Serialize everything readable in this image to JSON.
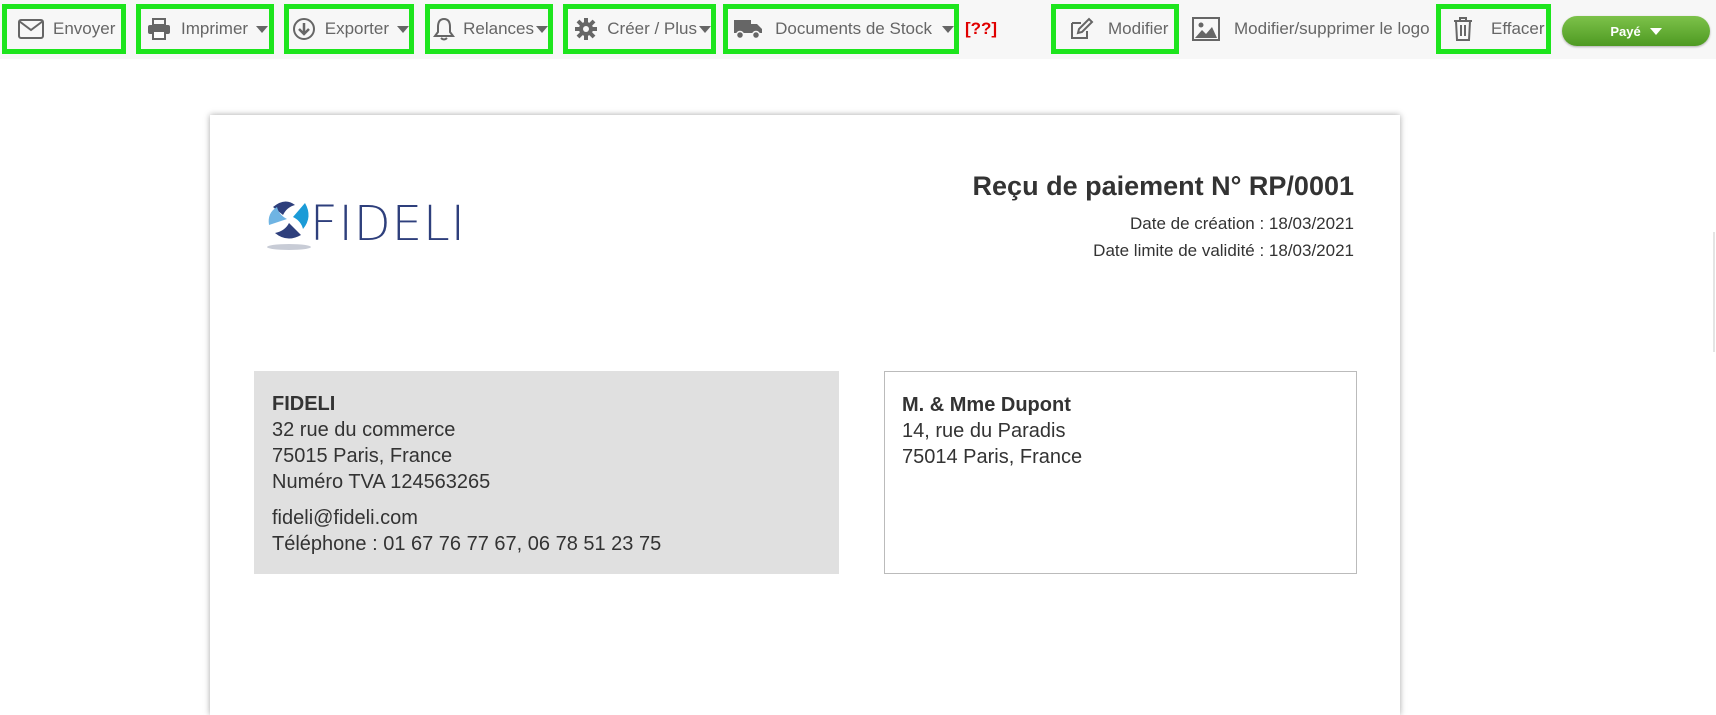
{
  "toolbar": {
    "send": "Envoyer",
    "print": "Imprimer",
    "export": "Exporter",
    "reminders": "Relances",
    "create": "Créer / Plus",
    "stock": "Documents de Stock",
    "warning": "[??]",
    "edit": "Modifier",
    "logo": "Modifier/supprimer le logo",
    "delete": "Effacer",
    "status": "Payé"
  },
  "document": {
    "logo_text": "FIDELI",
    "title": "Reçu de paiement N° RP/0001",
    "created": "Date de création : 18/03/2021",
    "valid": "Date limite de validité : 18/03/2021",
    "sender": {
      "name": "FIDELI",
      "street": "32 rue du commerce",
      "city": "75015 Paris, France",
      "vat": "Numéro TVA 124563265",
      "email": "fideli@fideli.com",
      "phone": "Téléphone : 01 67 76 77 67, 06 78 51 23 75"
    },
    "recipient": {
      "name": "M. & Mme Dupont",
      "street": "14, rue du Paradis",
      "city": "75014 Paris, France"
    }
  },
  "colors": {
    "highlight": "#1de51d",
    "status_button": "#5fab2f",
    "warning": "#e00000",
    "logo_blue": "#2e3f7c"
  }
}
